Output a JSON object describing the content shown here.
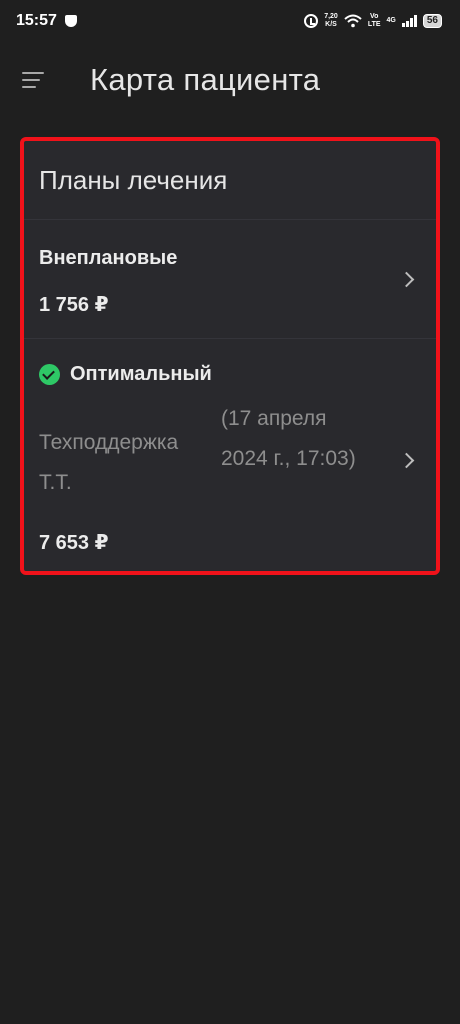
{
  "status_bar": {
    "time": "15:57",
    "net_speed_top": "7,20",
    "net_speed_unit": "K/S",
    "volte_top": "Vo",
    "volte_bottom": "LTE",
    "network": "4G",
    "battery": "56"
  },
  "header": {
    "title": "Карта пациента"
  },
  "card": {
    "title": "Планы лечения",
    "plans": [
      {
        "name": "Внеплановые",
        "price": "1 756 ₽"
      },
      {
        "name": "Оптимальный",
        "status": "selected",
        "author": "Техподдержка Т.Т.",
        "date": "(17 апреля 2024 г., 17:03)",
        "price": "7 653 ₽"
      }
    ]
  },
  "colors": {
    "background": "#1f1f1f",
    "card": "#29292d",
    "highlight_border": "#f0121a",
    "check_green": "#2ec866"
  },
  "icons": [
    "menu-icon",
    "check-circle-icon",
    "chevron-right-icon"
  ]
}
